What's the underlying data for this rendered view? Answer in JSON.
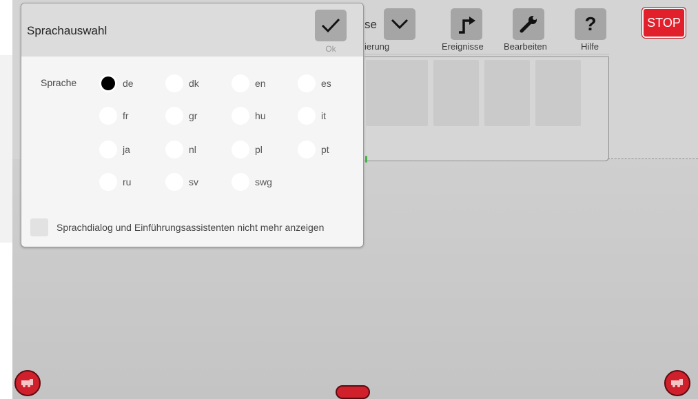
{
  "toolbar": {
    "partial_dropdown_text": "se",
    "partial_dropdown_label": "ierung",
    "events_label": "Ereignisse",
    "edit_label": "Bearbeiten",
    "help_label": "Hilfe",
    "help_glyph": "?",
    "stop_label": "STOP"
  },
  "dialog": {
    "title": "Sprachauswahl",
    "ok_label": "Ok",
    "language_label": "Sprache",
    "selected_language": "de",
    "languages": [
      "de",
      "dk",
      "en",
      "es",
      "fr",
      "gr",
      "hu",
      "it",
      "ja",
      "nl",
      "pl",
      "pt",
      "ru",
      "sv",
      "swg"
    ],
    "dont_show_again_label": "Sprachdialog und Einführungsassistenten nicht mehr anzeigen",
    "dont_show_again_checked": false
  },
  "colors": {
    "accent_red": "#e2202c",
    "button_gray": "#a5a5a5"
  }
}
